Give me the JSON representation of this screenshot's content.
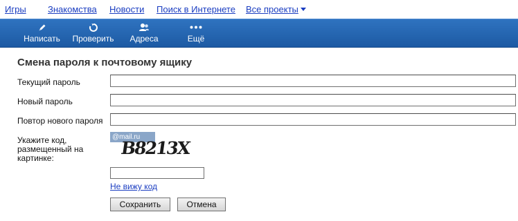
{
  "topnav": {
    "games": "Игры",
    "dating": "Знакомства",
    "news": "Новости",
    "search": "Поиск в Интернете",
    "all_projects": "Все проекты"
  },
  "toolbar": {
    "compose": "Написать",
    "check": "Проверить",
    "addresses": "Адреса",
    "more": "Ещё"
  },
  "form": {
    "title": "Смена пароля к почтовому ящику",
    "current_password_label": "Текущий пароль",
    "new_password_label": "Новый пароль",
    "repeat_password_label": "Повтор нового пароля",
    "captcha_label": "Укажите код, размещенный на картинке:",
    "captcha_brand": "@mail.ru",
    "captcha_code": "B8213X",
    "cant_see_code": "Не вижу код",
    "save": "Сохранить",
    "cancel": "Отмена"
  },
  "colors": {
    "toolbar_bg": "#2a68b2",
    "link": "#1a3dc1"
  },
  "icons": [
    "pencil-icon",
    "refresh-icon",
    "contacts-icon",
    "more-dots-icon",
    "chevron-down-icon"
  ]
}
